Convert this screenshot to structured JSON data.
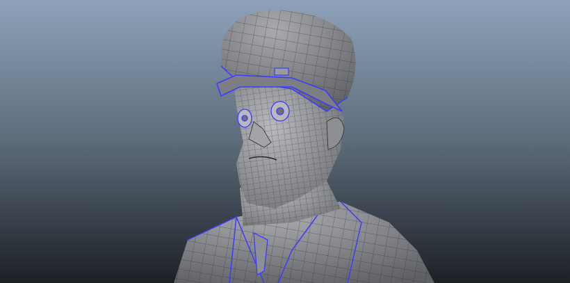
{
  "scene": {
    "subject": "character-bust-wireframe",
    "colors": {
      "background_top": "#8da2ba",
      "background_mid": "#5d6b7a",
      "background_bottom": "#1c2025",
      "mesh_fill": "#8e8f92",
      "mesh_light": "#b4b5b8",
      "wire": "#2a2c34",
      "border_edges": "#3b3bff"
    }
  }
}
